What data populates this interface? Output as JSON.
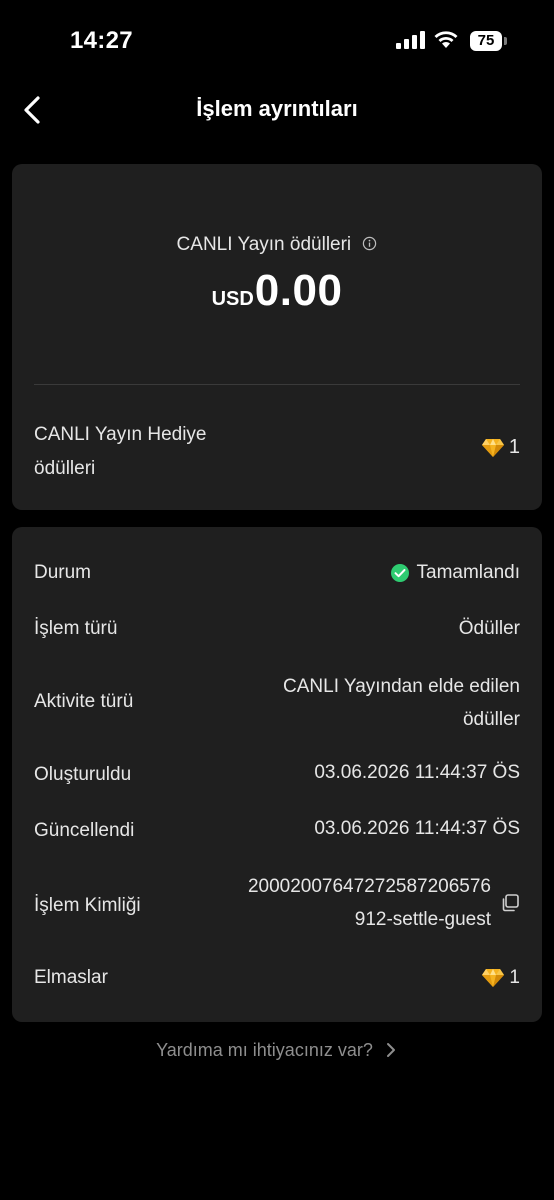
{
  "status_bar": {
    "time": "14:27",
    "battery": "75"
  },
  "header": {
    "title": "İşlem ayrıntıları"
  },
  "summary": {
    "label": "CANLI Yayın ödülleri",
    "currency": "USD",
    "amount": "0.00",
    "gift_label_line1": "CANLI Yayın Hediye",
    "gift_label_line2": "ödülleri",
    "gift_value": "1"
  },
  "details": {
    "status_label": "Durum",
    "status_value": "Tamamlandı",
    "status_color": "#2ecc71",
    "type_label": "İşlem türü",
    "type_value": "Ödüller",
    "activity_label": "Aktivite türü",
    "activity_value_line1": "CANLI Yayından elde edilen",
    "activity_value_line2": "ödüller",
    "created_label": "Oluşturuldu",
    "created_value": "03.06.2026 11:44:37 ÖS",
    "updated_label": "Güncellendi",
    "updated_value": "03.06.2026 11:44:37 ÖS",
    "id_label": "İşlem Kimliği",
    "id_value_line1": "20002007647272587206576",
    "id_value_line2": "912-settle-guest",
    "diamonds_label": "Elmaslar",
    "diamonds_value": "1"
  },
  "help": {
    "label": "Yardıma mı ihtiyacınız var?"
  },
  "icons": [
    "back-arrow-icon",
    "info-icon",
    "diamond-icon",
    "check-circle-icon",
    "copy-icon",
    "chevron-right-icon",
    "signal-icon",
    "wifi-icon",
    "battery-icon"
  ]
}
